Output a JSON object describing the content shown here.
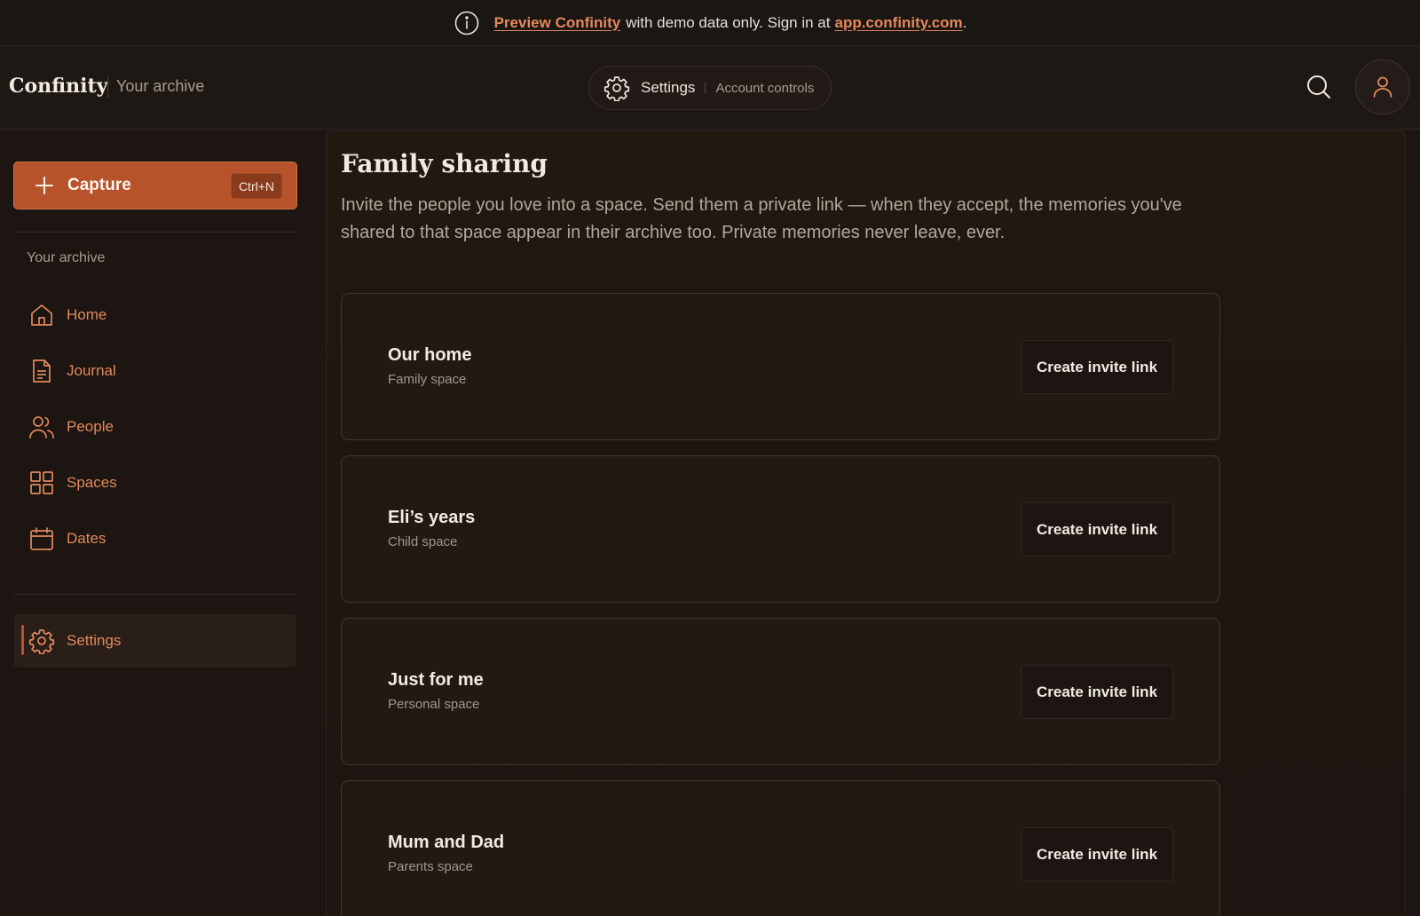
{
  "banner": {
    "icon": "info-icon",
    "link_text": "Preview Confinity",
    "middle_text": "with demo data only. Sign in at",
    "url_text": "app.confinity.com",
    "end_text": "."
  },
  "header": {
    "brand": "Confinity",
    "subtitle": "Your archive",
    "settings_label": "Settings",
    "settings_sub": "Account controls"
  },
  "sidebar": {
    "capture_label": "Capture",
    "capture_shortcut": "Ctrl+N",
    "section_heading": "Your archive",
    "items": [
      {
        "label": "Home",
        "icon": "home-icon"
      },
      {
        "label": "Journal",
        "icon": "document-icon"
      },
      {
        "label": "People",
        "icon": "people-icon"
      },
      {
        "label": "Spaces",
        "icon": "grid-icon"
      },
      {
        "label": "Dates",
        "icon": "calendar-icon"
      }
    ],
    "settings_label": "Settings"
  },
  "main": {
    "title": "Family sharing",
    "description": "Invite the people you love into a space. Send them a private link — when they accept, the memories you've shared to that space appear in their archive too. Private memories never leave, ever.",
    "spaces": [
      {
        "name": "Our home",
        "type": "Family space",
        "button": "Create invite link"
      },
      {
        "name": "Eli’s years",
        "type": "Child space",
        "button": "Create invite link"
      },
      {
        "name": "Just for me",
        "type": "Personal space",
        "button": "Create invite link"
      },
      {
        "name": "Mum and Dad",
        "type": "Parents space",
        "button": "Create invite link"
      }
    ]
  },
  "colors": {
    "accent": "#e1895d",
    "capture": "#b7532b",
    "background": "#1c1511"
  }
}
